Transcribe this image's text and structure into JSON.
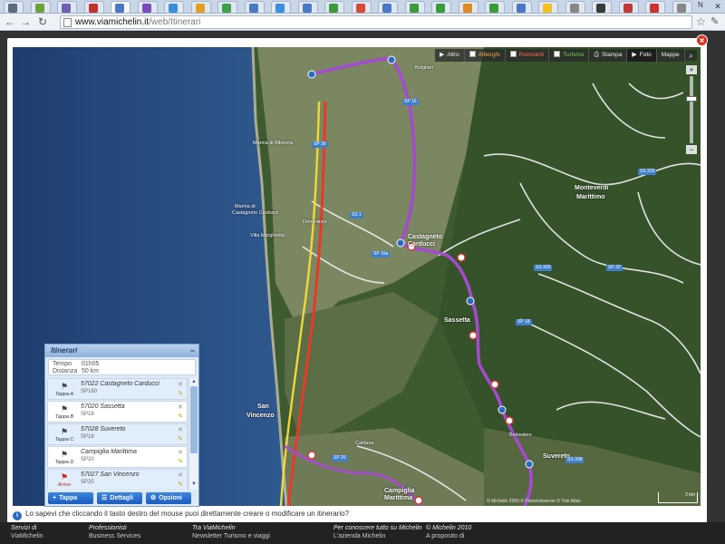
{
  "browser": {
    "tabs": [
      {
        "color": "#5b6a80"
      },
      {
        "color": "#6da03a"
      },
      {
        "color": "#6e5fb0"
      },
      {
        "color": "#c0322e"
      },
      {
        "color": "#4a78c4",
        "active": true
      },
      {
        "color": "#7a4cb6"
      },
      {
        "color": "#3a8edb"
      },
      {
        "color": "#e0a020"
      },
      {
        "color": "#3fa04a"
      },
      {
        "color": "#4a78c4"
      },
      {
        "color": "#3a8edb"
      },
      {
        "color": "#4a78c4"
      },
      {
        "color": "#3b9b3b"
      },
      {
        "color": "#d84a3a"
      },
      {
        "color": "#4a78c4"
      },
      {
        "color": "#3b9b3b"
      },
      {
        "color": "#3b9b3b"
      },
      {
        "color": "#dd8a20"
      },
      {
        "color": "#3b9b3b"
      },
      {
        "color": "#4a78c4"
      },
      {
        "color": "#f0c020"
      },
      {
        "color": "#888888"
      },
      {
        "color": "#3a3a3a"
      },
      {
        "color": "#c03a3a"
      },
      {
        "color": "#cc3333"
      },
      {
        "color": "#888888"
      }
    ],
    "last_tab_label": "N",
    "url_host": "www.viamichelin.it",
    "url_path": "/web/Itinerari",
    "icons": {
      "back": "back-arrow-icon",
      "forward": "forward-arrow-icon",
      "reload": "reload-icon",
      "star": "bookmark-star-icon",
      "wrench": "wrench-icon"
    }
  },
  "map_toolbar": {
    "items": [
      {
        "label": "Altro",
        "kind": "arrow"
      },
      {
        "label": "Alberghi",
        "kind": "checkbox",
        "tone": "orange"
      },
      {
        "label": "Ristoranti",
        "kind": "checkbox",
        "tone": "red"
      },
      {
        "label": "Turismo",
        "kind": "checkbox",
        "tone": "green"
      },
      {
        "label": "Stampa",
        "kind": "print"
      },
      {
        "label": "Foto",
        "kind": "arrow",
        "active": true
      },
      {
        "label": "Mappe",
        "kind": "plain"
      }
    ]
  },
  "map_labels": [
    {
      "text": "Castagneto",
      "big": true
    },
    {
      "text": "Carducci",
      "big": true
    },
    {
      "text": "Sassetta",
      "big": true
    },
    {
      "text": "Monteverdi",
      "big": true
    },
    {
      "text": "Marittimo",
      "big": true
    },
    {
      "text": "San",
      "big": true
    },
    {
      "text": "Vincenzo",
      "big": true
    },
    {
      "text": "Campiglia",
      "big": true
    },
    {
      "text": "Marittima",
      "big": true
    },
    {
      "text": "Suvereto",
      "big": true
    },
    {
      "text": "Donoratico"
    },
    {
      "text": "Bolgheri"
    },
    {
      "text": "Marina di"
    },
    {
      "text": "Castagneto Carducci"
    },
    {
      "text": "Marina di Bibbona"
    },
    {
      "text": "Villa Margherita"
    },
    {
      "text": "Belvedere"
    },
    {
      "text": "Caldana"
    }
  ],
  "road_badges": [
    "SP 16",
    "SS 329",
    "SS 398",
    "SS 1",
    "SP 39",
    "SP 20",
    "SP 18",
    "SS 329",
    "SP 16a",
    "SP 20"
  ],
  "map_copyright": "© Michelin 2009 © Planetobserver © Tele Atlas",
  "scale_label": "2 km",
  "itinerary": {
    "title": "Itinerari",
    "summary": [
      {
        "key": "Tempo",
        "value": "01h05"
      },
      {
        "key": "Distanza",
        "value": "50 km"
      }
    ],
    "steps": [
      {
        "tag": "Tappa A",
        "title": "57022 Castagneto Carducci",
        "sub": "SP160",
        "hl": true
      },
      {
        "tag": "Tappa B",
        "title": "57020 Sassetta",
        "sub": "SP18",
        "hl": false
      },
      {
        "tag": "Tappa C",
        "title": "57028 Suvereto",
        "sub": "SP18",
        "hl": true
      },
      {
        "tag": "Tappa D",
        "title": "Campiglia Marittima",
        "sub": "SP20",
        "hl": false
      },
      {
        "tag": "Arrivo",
        "title": "57027 San Vincenzo",
        "sub": "SP20",
        "hl": true,
        "end": true
      }
    ],
    "buttons": [
      {
        "label": "Tappa",
        "icon": "plus-icon"
      },
      {
        "label": "Dettagli",
        "icon": "list-icon"
      },
      {
        "label": "Opzioni",
        "icon": "gear-icon"
      }
    ]
  },
  "hint": "Lo sapevi che cliccando il tasto destro del mouse puoi direttamente creare o modificare un itinerario?",
  "footer": [
    {
      "heading": "Servizi di",
      "line": "ViaMichelin"
    },
    {
      "heading": "Professionisti",
      "line": "Business Services"
    },
    {
      "heading": "Tra ViaMichelin",
      "line": "Newsletter Turismo e viaggi"
    },
    {
      "heading": "Per conoscere tutto su Michelin",
      "line": "L'azienda Michelin"
    },
    {
      "heading": "© Michelin 2010",
      "line": "A proposito di"
    }
  ]
}
